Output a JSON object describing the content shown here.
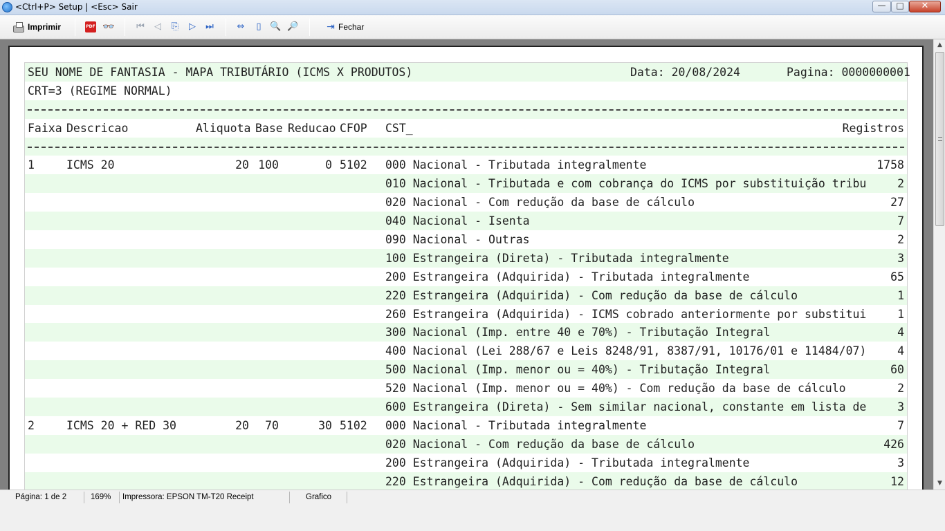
{
  "window": {
    "title": "<Ctrl+P> Setup | <Esc> Sair",
    "minimize_glyph": "—",
    "maximize_glyph": "□",
    "close_glyph": "✕"
  },
  "toolbar": {
    "print_label": "Imprimir",
    "close_label": "Fechar",
    "icons": [
      "printer-icon",
      "pdf-icon",
      "find-icon",
      "first-page-icon",
      "prev-page-icon",
      "goto-page-icon",
      "next-page-icon",
      "last-page-icon",
      "page-width-icon",
      "whole-page-icon",
      "zoom-in-icon",
      "zoom-out-icon",
      "exit-icon"
    ]
  },
  "report": {
    "header_title": "SEU NOME DE FANTASIA - MAPA TRIBUTÁRIO (ICMS X PRODUTOS)",
    "header_date": "Data: 20/08/2024",
    "header_page": "Pagina: 0000000001",
    "crt": "CRT=3 (REGIME NORMAL)",
    "columns": {
      "faixa": "Faixa",
      "descricao": "Descricao",
      "aliquota": "Aliquota",
      "base": "Base",
      "reducao": "Reducao",
      "cfop": "CFOP",
      "cst": "CST_",
      "registros": "Registros"
    },
    "rows": [
      {
        "faixa": "1",
        "descricao": "ICMS 20",
        "aliquota": "20",
        "base": "100",
        "reducao": "0",
        "cfop": "5102",
        "cst": "000 Nacional - Tributada integralmente",
        "registros": "1758"
      },
      {
        "faixa": "",
        "descricao": "",
        "aliquota": "",
        "base": "",
        "reducao": "",
        "cfop": "",
        "cst": "010 Nacional - Tributada e com cobrança do ICMS por substituição tribu",
        "registros": "2"
      },
      {
        "faixa": "",
        "descricao": "",
        "aliquota": "",
        "base": "",
        "reducao": "",
        "cfop": "",
        "cst": "020 Nacional - Com redução da base de cálculo",
        "registros": "27"
      },
      {
        "faixa": "",
        "descricao": "",
        "aliquota": "",
        "base": "",
        "reducao": "",
        "cfop": "",
        "cst": "040 Nacional - Isenta",
        "registros": "7"
      },
      {
        "faixa": "",
        "descricao": "",
        "aliquota": "",
        "base": "",
        "reducao": "",
        "cfop": "",
        "cst": "090 Nacional - Outras",
        "registros": "2"
      },
      {
        "faixa": "",
        "descricao": "",
        "aliquota": "",
        "base": "",
        "reducao": "",
        "cfop": "",
        "cst": "100 Estrangeira (Direta) - Tributada integralmente",
        "registros": "3"
      },
      {
        "faixa": "",
        "descricao": "",
        "aliquota": "",
        "base": "",
        "reducao": "",
        "cfop": "",
        "cst": "200 Estrangeira (Adquirida) - Tributada integralmente",
        "registros": "65"
      },
      {
        "faixa": "",
        "descricao": "",
        "aliquota": "",
        "base": "",
        "reducao": "",
        "cfop": "",
        "cst": "220 Estrangeira (Adquirida) - Com redução da base de cálculo",
        "registros": "1"
      },
      {
        "faixa": "",
        "descricao": "",
        "aliquota": "",
        "base": "",
        "reducao": "",
        "cfop": "",
        "cst": "260 Estrangeira (Adquirida) - ICMS cobrado anteriormente por substitui",
        "registros": "1"
      },
      {
        "faixa": "",
        "descricao": "",
        "aliquota": "",
        "base": "",
        "reducao": "",
        "cfop": "",
        "cst": "300 Nacional (Imp. entre 40 e 70%) - Tributação Integral",
        "registros": "4"
      },
      {
        "faixa": "",
        "descricao": "",
        "aliquota": "",
        "base": "",
        "reducao": "",
        "cfop": "",
        "cst": "400 Nacional (Lei 288/67 e Leis 8248/91, 8387/91, 10176/01 e 11484/07)",
        "registros": "4"
      },
      {
        "faixa": "",
        "descricao": "",
        "aliquota": "",
        "base": "",
        "reducao": "",
        "cfop": "",
        "cst": "500 Nacional (Imp. menor ou = 40%) - Tributação Integral",
        "registros": "60"
      },
      {
        "faixa": "",
        "descricao": "",
        "aliquota": "",
        "base": "",
        "reducao": "",
        "cfop": "",
        "cst": "520 Nacional (Imp. menor ou = 40%) - Com redução da base de cálculo",
        "registros": "2"
      },
      {
        "faixa": "",
        "descricao": "",
        "aliquota": "",
        "base": "",
        "reducao": "",
        "cfop": "",
        "cst": "600 Estrangeira (Direta) - Sem similar nacional, constante em lista de",
        "registros": "3"
      },
      {
        "faixa": "2",
        "descricao": "ICMS 20 + RED 30",
        "aliquota": "20",
        "base": "70",
        "reducao": "30",
        "cfop": "5102",
        "cst": "000 Nacional - Tributada integralmente",
        "registros": "7"
      },
      {
        "faixa": "",
        "descricao": "",
        "aliquota": "",
        "base": "",
        "reducao": "",
        "cfop": "",
        "cst": "020 Nacional - Com redução da base de cálculo",
        "registros": "426"
      },
      {
        "faixa": "",
        "descricao": "",
        "aliquota": "",
        "base": "",
        "reducao": "",
        "cfop": "",
        "cst": "200 Estrangeira (Adquirida) - Tributada integralmente",
        "registros": "3"
      },
      {
        "faixa": "",
        "descricao": "",
        "aliquota": "",
        "base": "",
        "reducao": "",
        "cfop": "",
        "cst": "220 Estrangeira (Adquirida) - Com redução da base de cálculo",
        "registros": "12"
      }
    ]
  },
  "statusbar": {
    "page": "Página: 1 de 2",
    "zoom": "169%",
    "printer": "Impressora: EPSON TM-T20 Receipt",
    "mode": "Grafico"
  },
  "colors": {
    "row_stripe": "#eafbea",
    "viewer_background": "#808080"
  }
}
